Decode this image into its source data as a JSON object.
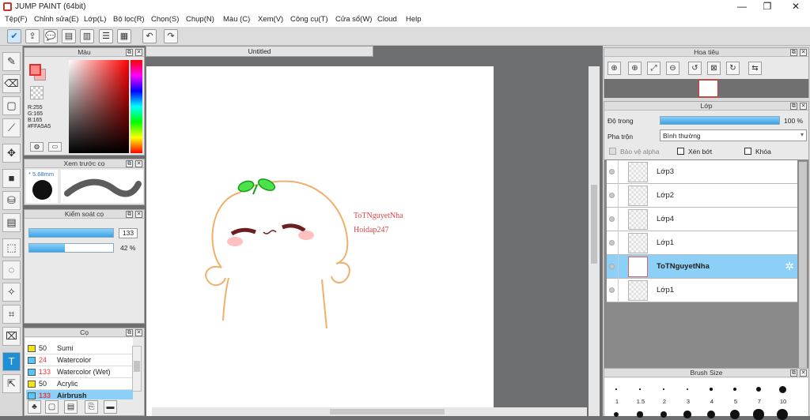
{
  "window": {
    "title": "JUMP PAINT (64bit)",
    "minimize": "—",
    "maximize": "❐",
    "close": "✕"
  },
  "menu": [
    "Tệp(F)",
    "Chỉnh sửa(E)",
    "Lớp(L)",
    "Bộ lọc(R)",
    "Chọn(S)",
    "Chụp(N)",
    "Màu (C)",
    "Xem(V)",
    "Công cụ(T)",
    "Cửa sổ(W)",
    "Cloud",
    "Help"
  ],
  "color_panel": {
    "title": "Màu",
    "r": "R:255",
    "g": "G:165",
    "b": "B:165",
    "hex": "#FFA5A5",
    "main_color": "#ff8a8a"
  },
  "brush_preview": {
    "title": "Xem trước cọ",
    "size": "* 5.68mm"
  },
  "brush_control": {
    "title": "Kiểm soát cọ",
    "size_value": "133",
    "opacity_value": "42 %",
    "size_fraction": 1.0,
    "opacity_fraction": 0.42
  },
  "brush_list": {
    "title": "Cọ",
    "items": [
      {
        "size": "50",
        "name": "Sumi",
        "color": "#f3e11c",
        "size_color": "#222"
      },
      {
        "size": "24",
        "name": "Watercolor",
        "color": "#56c7f5",
        "size_color": "#e03c3c"
      },
      {
        "size": "133",
        "name": "Watercolor (Wet)",
        "color": "#56c7f5",
        "size_color": "#e03c3c"
      },
      {
        "size": "50",
        "name": "Acrylic",
        "color": "#f3e11c",
        "size_color": "#222"
      },
      {
        "size": "133",
        "name": "Airbrush",
        "color": "#56c7f5",
        "size_color": "#e03c3c"
      }
    ]
  },
  "document": {
    "tab": "Untitled",
    "text1": "ToTNguyetNha",
    "text2": "Hoidap247",
    "text_color": "#e04545"
  },
  "navigator": {
    "title": "Hoa tiêu"
  },
  "layers": {
    "title": "Lớp",
    "opacity_label": "Độ trong",
    "opacity_value": "100 %",
    "opacity_fraction": 1.0,
    "blend_label": "Pha trộn",
    "blend_value": "Bình thường",
    "protect_alpha": "Bảo vệ alpha",
    "clipping": "Xén bớt",
    "lock": "Khóa",
    "items": [
      {
        "name": "Lớp3",
        "selected": false
      },
      {
        "name": "Lớp2",
        "selected": false
      },
      {
        "name": "Lớp4",
        "selected": false
      },
      {
        "name": "Lớp1",
        "selected": false
      },
      {
        "name": "ToTNguyetNha",
        "selected": true
      },
      {
        "name": "Lớp1",
        "selected": false
      }
    ]
  },
  "brush_size": {
    "title": "Brush Size",
    "labels": [
      "1",
      "1.5",
      "2",
      "3",
      "4",
      "5",
      "7",
      "10"
    ]
  }
}
